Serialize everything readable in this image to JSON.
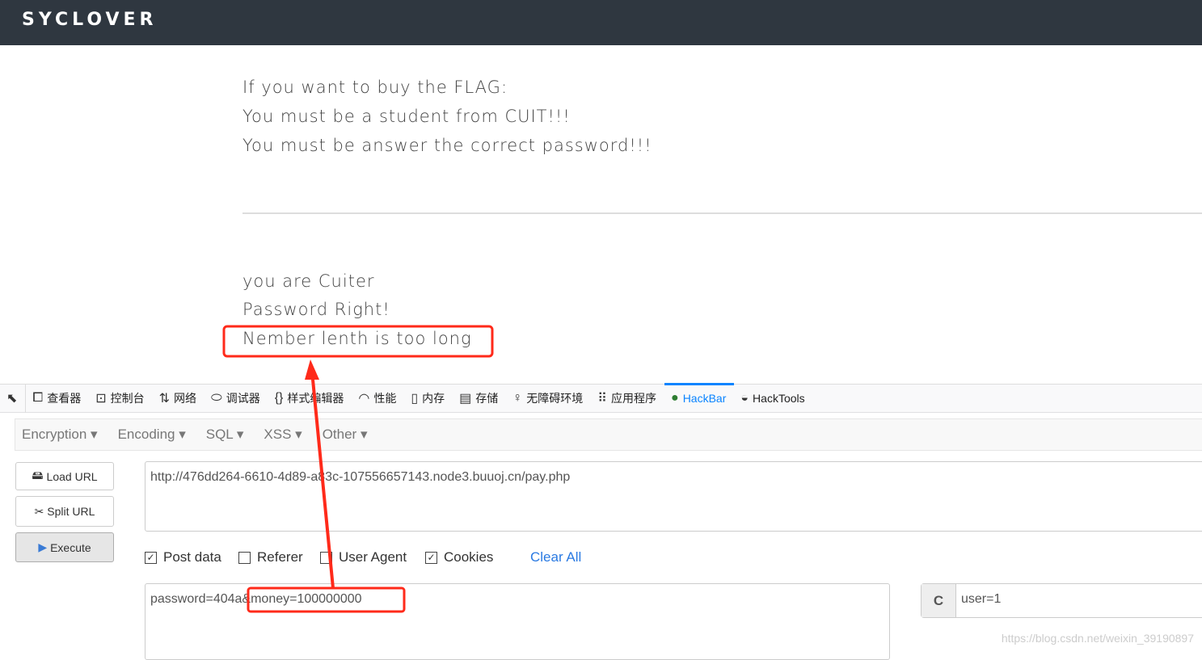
{
  "header": {
    "brand": "SYCLOVER"
  },
  "content": {
    "intro": [
      "If you want to buy the FLAG:",
      "You must be a student from CUIT!!!",
      "You must be answer the correct password!!!"
    ],
    "result": [
      "you are Cuiter",
      "Password Right!",
      "Nember lenth is too long"
    ]
  },
  "devtools": {
    "tabs": [
      {
        "icon": "inspector-icon",
        "label": "查看器"
      },
      {
        "icon": "console-icon",
        "label": "控制台"
      },
      {
        "icon": "network-icon",
        "label": "网络"
      },
      {
        "icon": "debugger-icon",
        "label": "调试器"
      },
      {
        "icon": "style-editor-icon",
        "label": "样式编辑器"
      },
      {
        "icon": "performance-icon",
        "label": "性能"
      },
      {
        "icon": "memory-icon",
        "label": "内存"
      },
      {
        "icon": "storage-icon",
        "label": "存储"
      },
      {
        "icon": "accessibility-icon",
        "label": "无障碍环境"
      },
      {
        "icon": "application-icon",
        "label": "应用程序"
      },
      {
        "icon": "hackbar-icon",
        "label": "HackBar",
        "active": true
      },
      {
        "icon": "hacktools-icon",
        "label": "HackTools"
      }
    ]
  },
  "hackbar": {
    "menus": [
      "Encryption",
      "Encoding",
      "SQL",
      "XSS",
      "Other"
    ],
    "buttons": {
      "load": "Load URL",
      "split": "Split URL",
      "execute": "Execute"
    },
    "url": "http://476dd264-6610-4d89-a83c-107556657143.node3.buuoj.cn/pay.php",
    "options": [
      {
        "label": "Post data",
        "checked": true
      },
      {
        "label": "Referer",
        "checked": false
      },
      {
        "label": "User Agent",
        "checked": false
      },
      {
        "label": "Cookies",
        "checked": true
      }
    ],
    "clear_all": "Clear All",
    "post_data": "password=404a&money=100000000",
    "cookie_label": "C",
    "cookie_value": "user=1"
  },
  "watermark": "https://blog.csdn.net/weixin_39190897",
  "annotation_color": "#ff2a1a"
}
